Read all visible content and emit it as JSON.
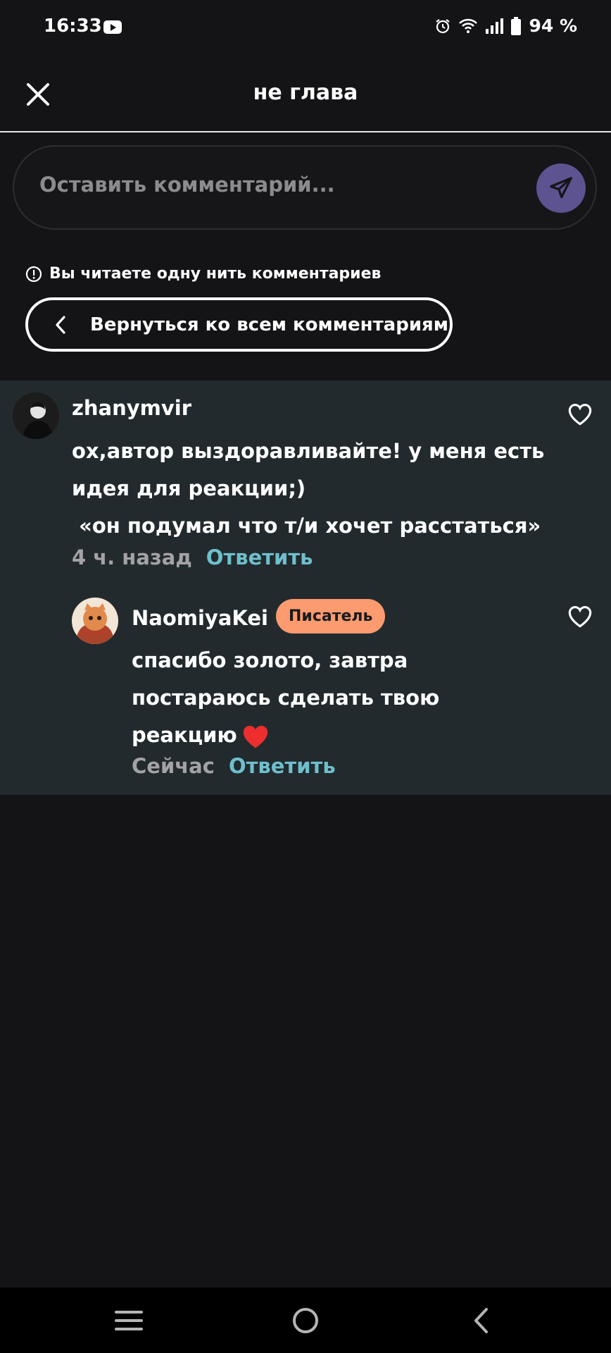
{
  "status_bar": {
    "time": "16:33",
    "battery": "94 %"
  },
  "header": {
    "title": "не глава"
  },
  "composer": {
    "placeholder": "Оставить комментарий..."
  },
  "thread_notice": {
    "text": "Вы читаете одну нить комментариев"
  },
  "back_button": {
    "label": "Вернуться ко всем комментариям"
  },
  "comments": [
    {
      "author": "zhanymvir",
      "text": "ох,автор выздоравливайте! у меня есть\nидея для реакции;)\n «он подумал что т/и хочет расстаться»",
      "time": "4 ч. назад",
      "reply_label": "Ответить"
    },
    {
      "author": "NaomiyaKei",
      "badge": "Писатель",
      "text": "спасибо золото, завтра\nпостараюсь сделать твою\nреакцию",
      "emoji": "heart-emoji",
      "time": "Сейчас",
      "reply_label": "Ответить"
    }
  ],
  "colors": {
    "accent_send": "#5c5390",
    "reply_link": "#6fbfcc",
    "badge": "#fb9b6f",
    "thread_bg": "#222a2d"
  }
}
